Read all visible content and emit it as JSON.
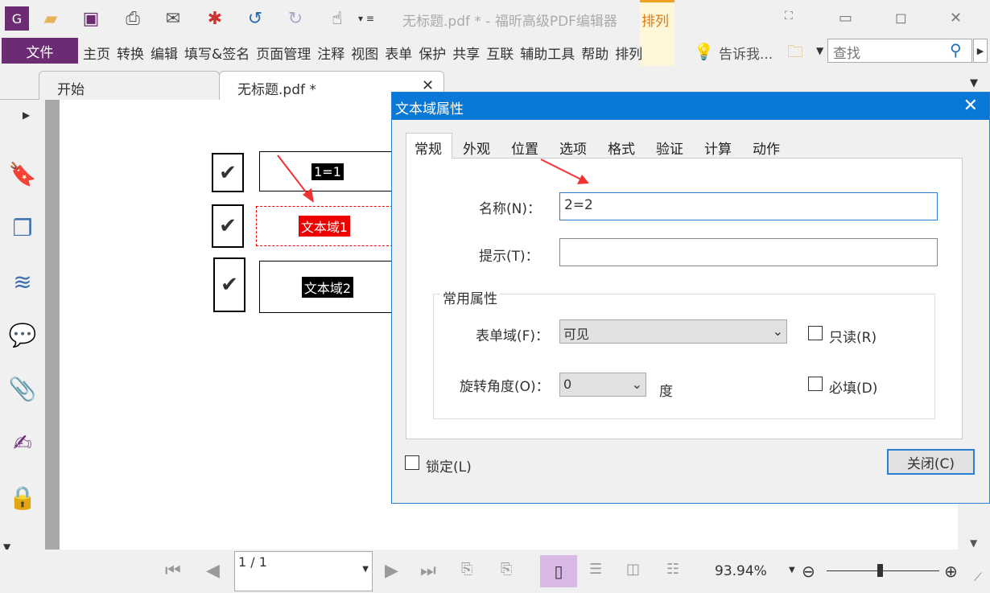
{
  "window": {
    "title": "无标题.pdf * - 福昕高级PDF编辑器",
    "arrange_tab": "排列"
  },
  "menu": {
    "file": "文件",
    "items": [
      "主页",
      "转换",
      "编辑",
      "填写&签名",
      "页面管理",
      "注释",
      "视图",
      "表单",
      "保护",
      "共享",
      "互联",
      "辅助工具",
      "帮助",
      "排列"
    ],
    "tell_me": "告诉我...",
    "search_placeholder": "查找"
  },
  "tabs": [
    {
      "label": "开始"
    },
    {
      "label": "无标题.pdf *"
    }
  ],
  "document": {
    "fields": [
      "1=1",
      "文本域1",
      "文本域2"
    ],
    "checkmark": "✔"
  },
  "bottom": {
    "page": "1 / 1",
    "zoom": "93.94%",
    "zoom_level": 0.45
  },
  "dialog": {
    "title": "文本域属性",
    "tabs": [
      "常规",
      "外观",
      "位置",
      "选项",
      "格式",
      "验证",
      "计算",
      "动作"
    ],
    "name_label": "名称(N)：",
    "name_value": "2=2",
    "tip_label": "提示(T)：",
    "tip_value": "",
    "group": "常用属性",
    "form_field_label": "表单域(F)：",
    "form_field_value": "可见",
    "rotation_label": "旋转角度(O)：",
    "rotation_value": "0",
    "degree": "度",
    "readonly": "只读(R)",
    "required": "必填(D)",
    "lock": "锁定(L)",
    "close": "关闭(C)"
  }
}
